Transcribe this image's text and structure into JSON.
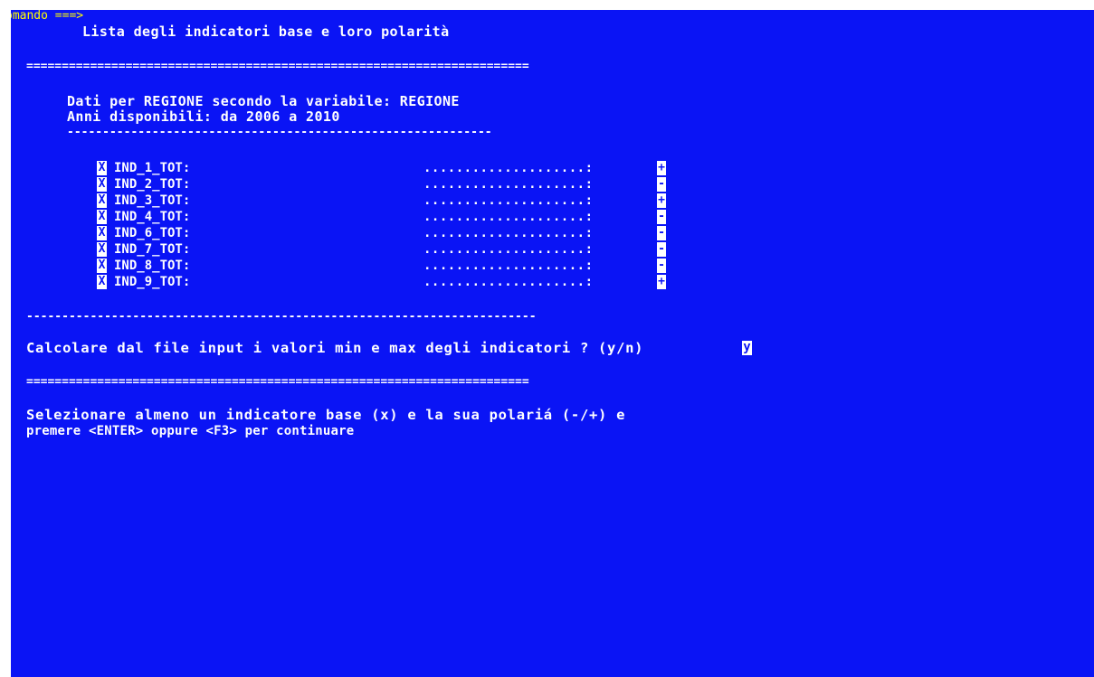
{
  "command": {
    "prompt": "omando ===>",
    "value": ""
  },
  "title": "Lista degli indicatori base e loro polarità",
  "rules": {
    "double": "=======================================================================",
    "dashed_long": "------------------------------------------------------------------------",
    "dashed_short": "------------------------------------------------------------"
  },
  "info": {
    "line1": "Dati per REGIONE secondo la variabile: REGIONE",
    "line2": "Anni disponibili: da 2006 a 2010"
  },
  "indicators": [
    {
      "selected": "X",
      "name": "IND_1_TOT:",
      "dots": "....................:",
      "polarity": "+"
    },
    {
      "selected": "X",
      "name": "IND_2_TOT:",
      "dots": "....................:",
      "polarity": "-"
    },
    {
      "selected": "X",
      "name": "IND_3_TOT:",
      "dots": "....................:",
      "polarity": "+"
    },
    {
      "selected": "X",
      "name": "IND_4_TOT:",
      "dots": "....................:",
      "polarity": "-"
    },
    {
      "selected": "X",
      "name": "IND_6_TOT:",
      "dots": "....................:",
      "polarity": "-"
    },
    {
      "selected": "X",
      "name": "IND_7_TOT:",
      "dots": "....................:",
      "polarity": "-"
    },
    {
      "selected": "X",
      "name": "IND_8_TOT:",
      "dots": "....................:",
      "polarity": "-"
    },
    {
      "selected": "X",
      "name": "IND_9_TOT:",
      "dots": "....................:",
      "polarity": "+"
    }
  ],
  "question": {
    "text": "Calcolare dal file input i valori min e max degli indicatori ? (y/n)",
    "answer": "y"
  },
  "instructions": {
    "line1": "Selezionare almeno un indicatore base (x) e la sua polariá (-/+) e",
    "line2": "premere <ENTER> oppure <F3> per continuare"
  },
  "colors": {
    "background": "#0a14f5",
    "text": "#ffffff",
    "command": "#ffff00"
  }
}
